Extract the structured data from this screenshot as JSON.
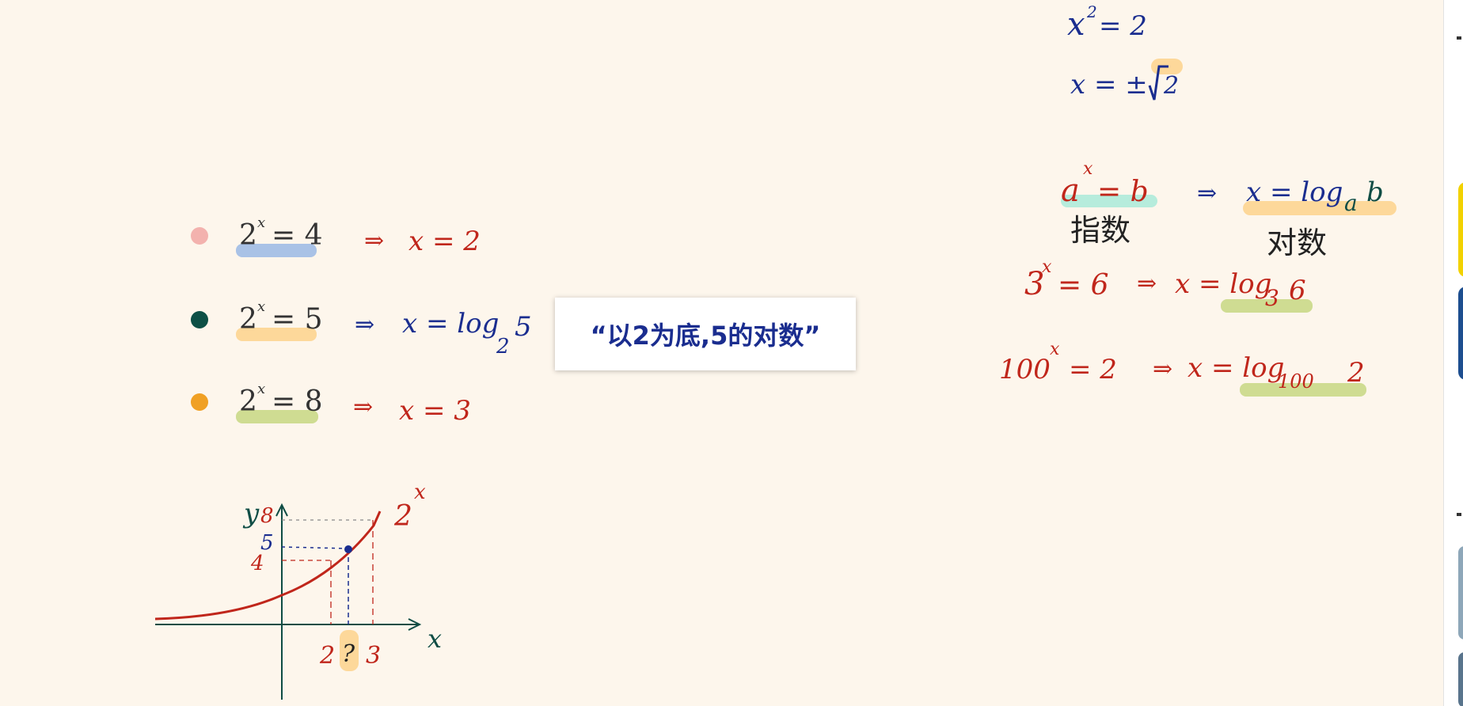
{
  "caption": "“以2为底,5的对数”",
  "left_rows": [
    {
      "lhs": "2",
      "exp": "x",
      "rhs": "= 4",
      "arrow": "⇒",
      "result": "x = 2"
    },
    {
      "lhs": "2",
      "exp": "x",
      "rhs": "= 5",
      "arrow": "⇒",
      "result": "x = log",
      "result_sub": "2",
      "result_end": "5"
    },
    {
      "lhs": "2",
      "exp": "x",
      "rhs": "= 8",
      "arrow": "⇒",
      "result": "x = 3"
    }
  ],
  "graph": {
    "curve_label": "2",
    "curve_label_exp": "x",
    "y_axis_label": "y",
    "x_axis_label": "x",
    "y_ticks": [
      "8",
      "5",
      "4"
    ],
    "x_ticks": [
      "2",
      "?",
      "3"
    ]
  },
  "right_notes": {
    "line1": {
      "base": "x",
      "exp": "2",
      "rhs": "= 2"
    },
    "line2": {
      "text": "x = ±",
      "root": "2"
    },
    "def": {
      "base": "a",
      "exp": "x",
      "eq": "= b",
      "arrow": "⇒",
      "rhs": "x = log",
      "rhs_sub": "a",
      "rhs_end": "b",
      "label_left": "指数",
      "label_right": "对数"
    },
    "ex1": {
      "base": "3",
      "exp": "x",
      "eq": "= 6",
      "arrow": "⇒",
      "rhs": "x = log",
      "rhs_sub": "3",
      "rhs_end": "6"
    },
    "ex2": {
      "base": "100",
      "exp": "x",
      "eq": "= 2",
      "arrow": "⇒",
      "rhs": "x = log",
      "rhs_sub": "100",
      "rhs_end": "2"
    }
  },
  "colors": {
    "background": "#fdf6ec",
    "red": "#c0261b",
    "navy": "#1a2d8f",
    "green": "#0f4d45",
    "dot_pink": "#f3b2ae",
    "dot_green": "#0d5046",
    "dot_orange": "#f0a024",
    "hl_blue": "#a9c2e6",
    "hl_orange": "#fdd89a",
    "hl_green": "#cfdc92",
    "hl_teal": "#b6ecdc"
  }
}
